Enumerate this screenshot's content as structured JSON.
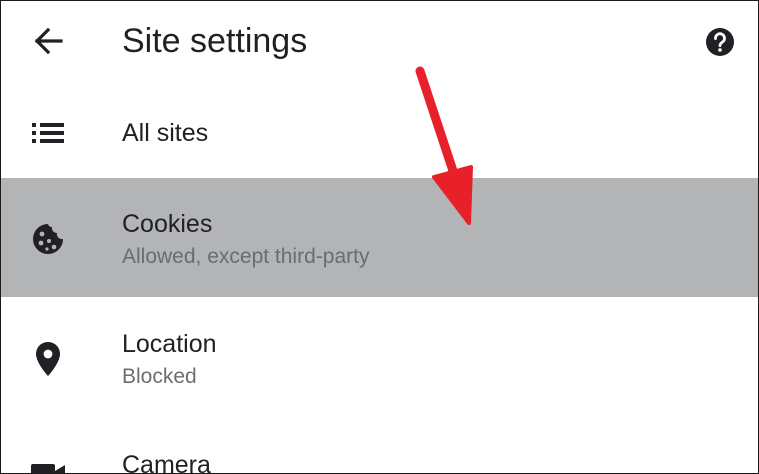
{
  "header": {
    "title": "Site settings",
    "back_icon": "arrow-back-icon",
    "help_icon": "help-icon"
  },
  "items": [
    {
      "label": "All sites",
      "icon": "list-icon"
    },
    {
      "label": "Cookies",
      "sublabel": "Allowed, except third-party",
      "icon": "cookie-icon",
      "highlighted": true
    },
    {
      "label": "Location",
      "sublabel": "Blocked",
      "icon": "location-pin-icon"
    },
    {
      "label": "Camera",
      "icon": "camera-icon"
    }
  ],
  "annotation": {
    "type": "arrow",
    "color": "#e8202a",
    "points_to": "Cookies"
  },
  "colors": {
    "highlight": "#b3b4b6",
    "text": "#202124",
    "subtext": "#6b6e72"
  }
}
